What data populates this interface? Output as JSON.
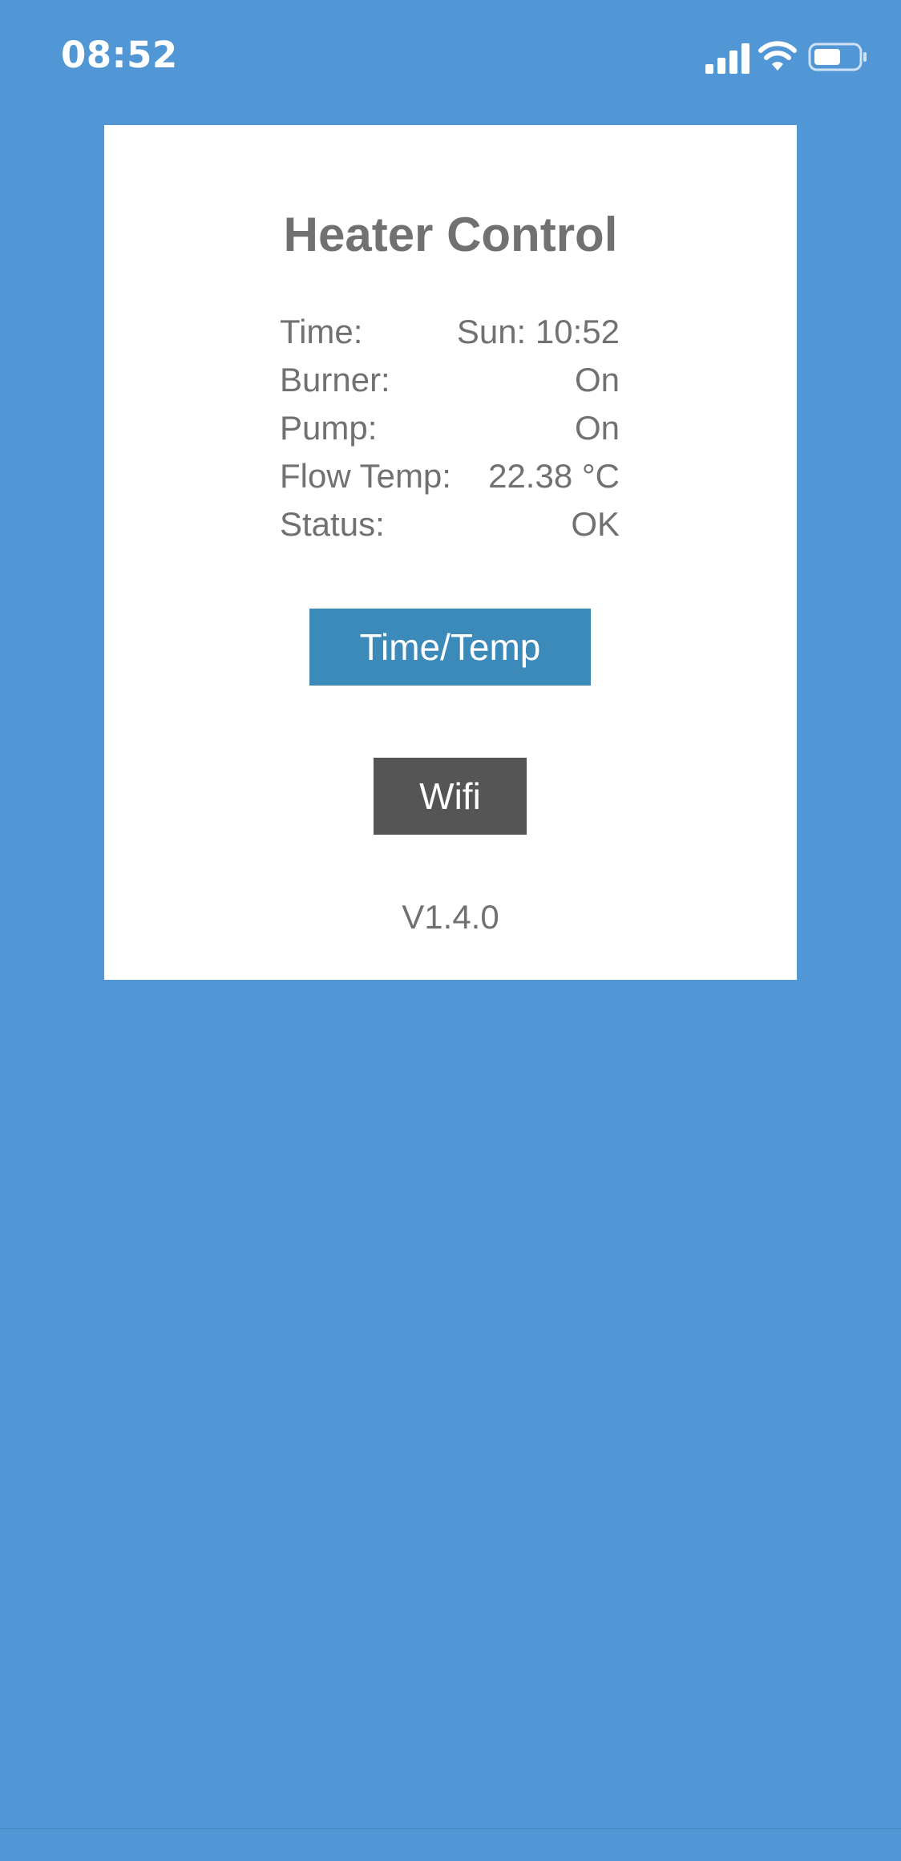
{
  "status_bar": {
    "time": "08:52",
    "icons": [
      "cellular-signal-icon",
      "wifi-icon",
      "battery-icon"
    ]
  },
  "app": {
    "title": "Heater Control",
    "rows": [
      {
        "label": "Time:",
        "value": "Sun: 10:52"
      },
      {
        "label": "Burner:",
        "value": "On"
      },
      {
        "label": "Pump:",
        "value": "On"
      },
      {
        "label": "Flow Temp:",
        "value": "22.38 °C"
      },
      {
        "label": "Status:",
        "value": "OK"
      }
    ],
    "buttons": {
      "time_temp": "Time/Temp",
      "wifi": "Wifi"
    },
    "version": "V1.4.0"
  },
  "colors": {
    "background": "#5197d5",
    "card": "#ffffff",
    "text": "#717171",
    "time_temp_button": "#3b8ab9",
    "wifi_button": "#555555"
  }
}
